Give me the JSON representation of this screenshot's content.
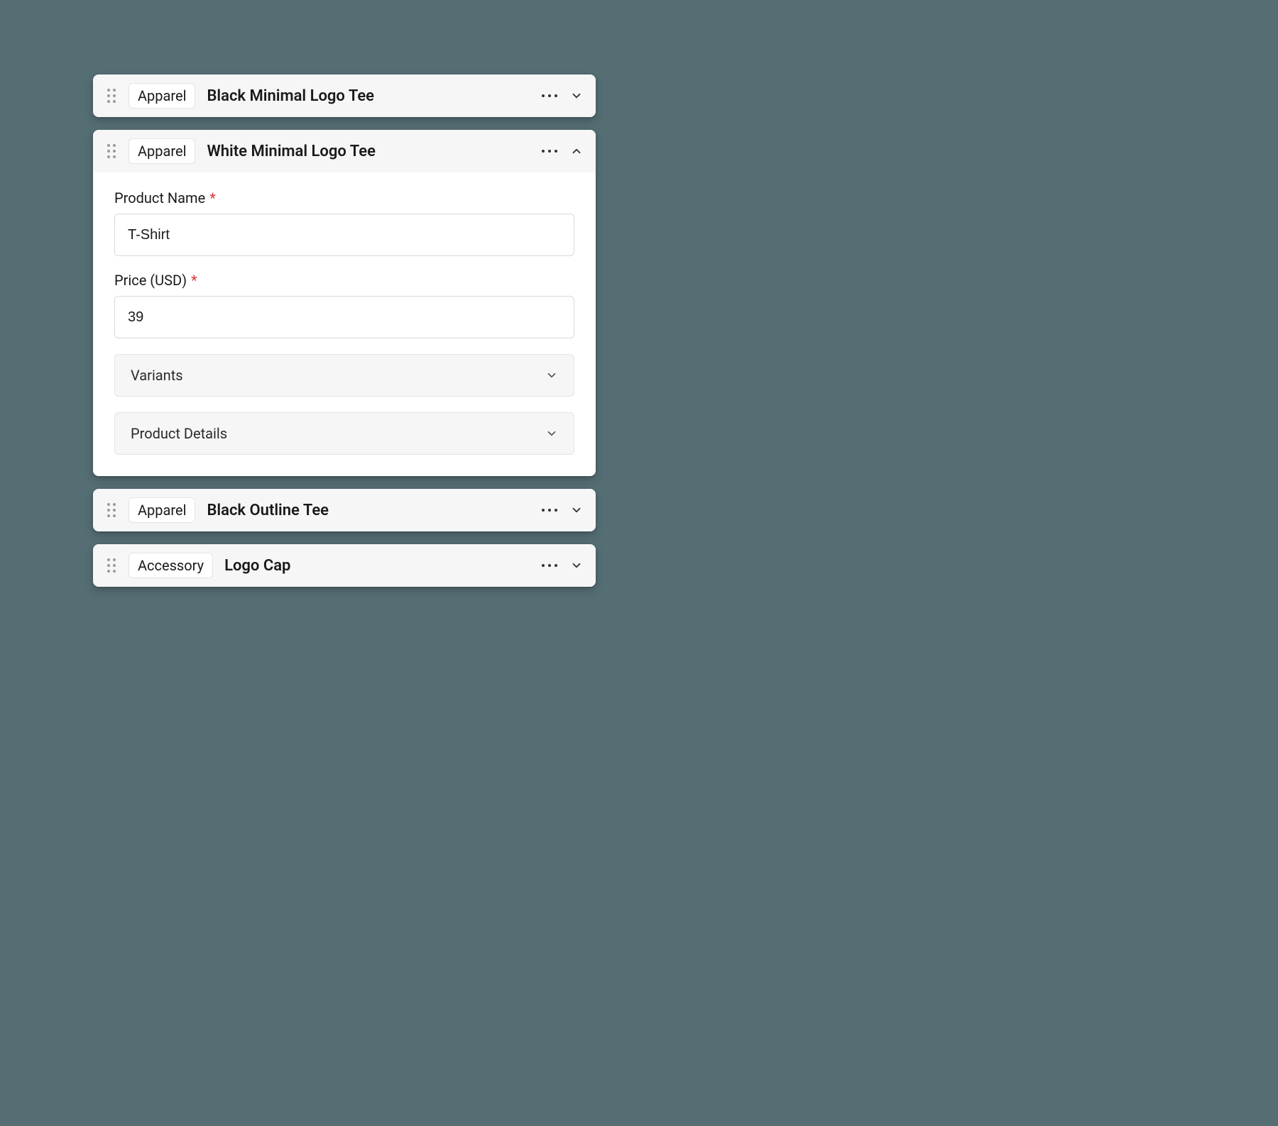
{
  "items": [
    {
      "category": "Apparel",
      "title": "Black Minimal Logo Tee",
      "expanded": false
    },
    {
      "category": "Apparel",
      "title": "White Minimal Logo Tee",
      "expanded": true
    },
    {
      "category": "Apparel",
      "title": "Black Outline Tee",
      "expanded": false
    },
    {
      "category": "Accessory",
      "title": "Logo Cap",
      "expanded": false
    }
  ],
  "form": {
    "product_name_label": "Product Name",
    "product_name_value": "T-Shirt",
    "price_label": "Price (USD)",
    "price_value": "39",
    "variants_label": "Variants",
    "details_label": "Product Details"
  }
}
